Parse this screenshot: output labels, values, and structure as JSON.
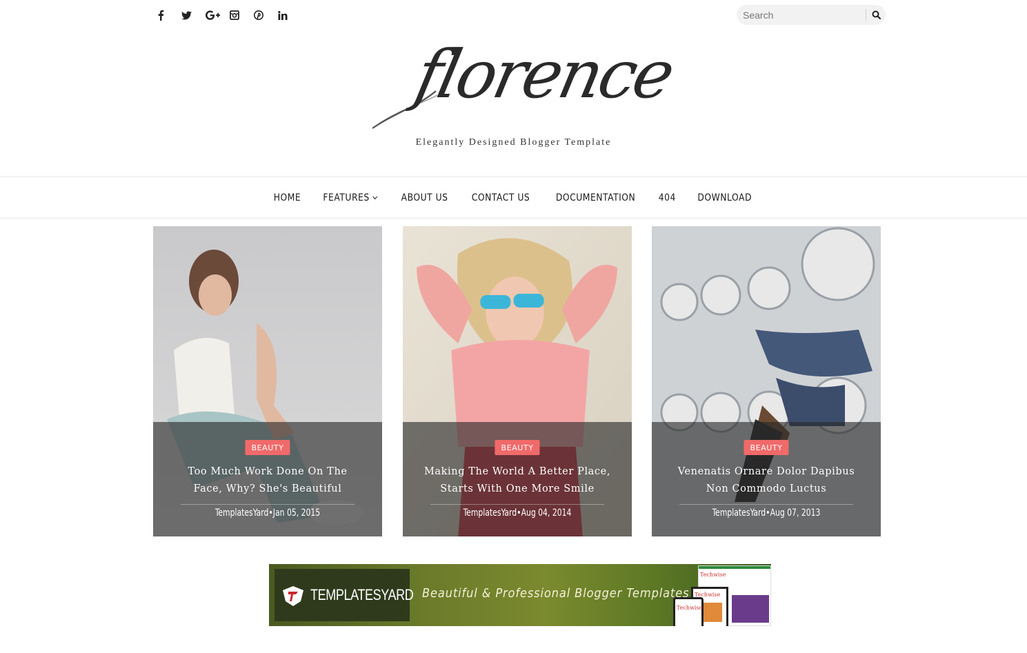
{
  "social": {
    "icons": [
      "facebook-icon",
      "twitter-icon",
      "google-plus-icon",
      "instagram-icon",
      "pinterest-icon",
      "linkedin-icon"
    ]
  },
  "search": {
    "placeholder": "Search",
    "button_icon": "search-icon"
  },
  "brand": {
    "logo_text": "florence",
    "tagline": "Elegantly Designed Blogger Template"
  },
  "nav": {
    "items": [
      {
        "label": "HOME"
      },
      {
        "label": "FEATURES",
        "has_dropdown": true
      },
      {
        "label": "ABOUT US"
      },
      {
        "label": "CONTACT US"
      },
      {
        "label": "DOCUMENTATION"
      },
      {
        "label": "404"
      },
      {
        "label": "DOWNLOAD"
      }
    ]
  },
  "posts": [
    {
      "category": "BEAUTY",
      "title_line1": "Too Much Work Done On The",
      "title_line2": "Face, Why? She's Beautiful",
      "author": "TemplatesYard",
      "date": "Jan 05, 2015"
    },
    {
      "category": "BEAUTY",
      "title_line1": "Making The World A Better Place,",
      "title_line2": "Starts With One More Smile",
      "author": "TemplatesYard",
      "date": "Aug 04, 2014"
    },
    {
      "category": "BEAUTY",
      "title_line1": "Venenatis Ornare Dolor Dapibus",
      "title_line2": "Non Commodo Luctus",
      "author": "TemplatesYard",
      "date": "Aug 07, 2013"
    }
  ],
  "meta_separator": "•",
  "banner": {
    "brand": "TEMPLATESYARD",
    "tagline": "Beautiful & Professional Blogger Templates",
    "screenshot_label": "Techwise"
  },
  "colors": {
    "badge": "#f06a6a",
    "overlay": "rgba(40,40,40,0.62)"
  }
}
